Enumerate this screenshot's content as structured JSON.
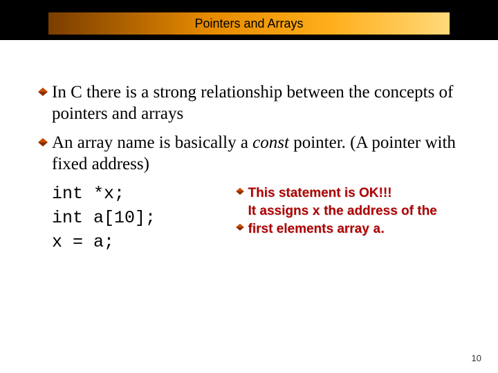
{
  "title": "Pointers and Arrays",
  "bullets": [
    "In C there is a strong relationship between the concepts of pointers and arrays",
    "An array name is basically a <span class=\"italic\">const</span> pointer. (A pointer with fixed address)"
  ],
  "code": {
    "l1": "int *x;",
    "l2": "int a[10];",
    "l3": "x = a;"
  },
  "note": {
    "line1": "This statement is OK!!!",
    "line2_pre": "It assigns ",
    "line2_x": "x",
    "line2_post": " the address of the",
    "line3_pre": "first elements array ",
    "line3_a": "a",
    "line3_post": "."
  },
  "page": "10"
}
